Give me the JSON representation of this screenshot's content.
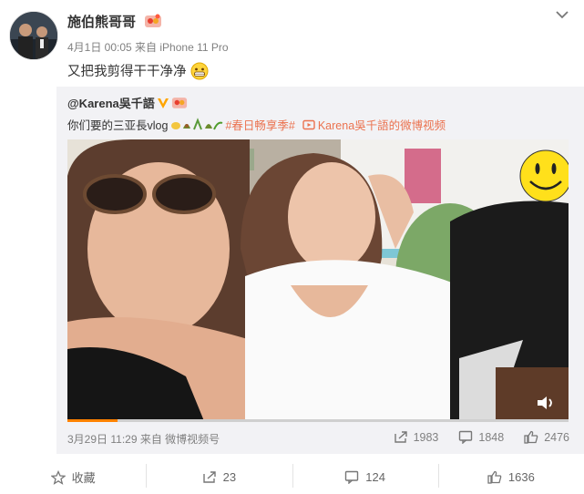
{
  "post": {
    "author": "施伯熊哥哥",
    "meta": "4月1日 00:05 来自 iPhone 11 Pro",
    "text": "又把我剪得干干净净"
  },
  "repost": {
    "user": "@Karena吳千語",
    "text": "你们要的三亚長vlog",
    "topic": "#春日畅享季#",
    "video_link": "Karena吳千語的微博视频",
    "meta": "3月29日 11:29 来自 微博视频号",
    "reposts": "1983",
    "comments": "1848",
    "likes": "2476",
    "video_progress": 0.1
  },
  "actions": {
    "favorite": "收藏",
    "repost_count": "23",
    "comment_count": "124",
    "like_count": "1636"
  },
  "colors": {
    "accent": "#eb7350",
    "verified": "#ffa500",
    "progress": "#ff8200"
  }
}
